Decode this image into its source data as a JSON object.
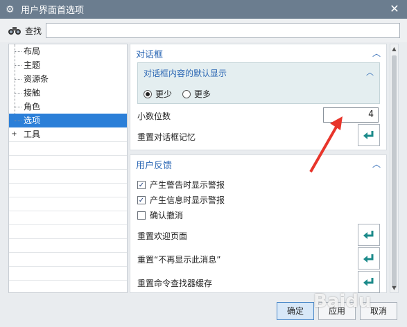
{
  "window": {
    "title": "用户界面首选项",
    "icons": {
      "app": "gear-icon",
      "close": "close-icon"
    }
  },
  "search": {
    "label": "查找",
    "value": "",
    "placeholder": ""
  },
  "tree": {
    "items": [
      {
        "label": "布局",
        "selected": false
      },
      {
        "label": "主题",
        "selected": false
      },
      {
        "label": "资源条",
        "selected": false
      },
      {
        "label": "接触",
        "selected": false
      },
      {
        "label": "角色",
        "selected": false
      },
      {
        "label": "选项",
        "selected": true
      },
      {
        "label": "工具",
        "selected": false,
        "expandable": true
      }
    ]
  },
  "dialog_section": {
    "title": "对话框",
    "subgroup": {
      "title": "对话框内容的默认显示",
      "options": [
        {
          "label": "更少",
          "checked": true
        },
        {
          "label": "更多",
          "checked": false
        }
      ]
    },
    "decimal_label": "小数位数",
    "decimal_value": "4",
    "reset_memory_label": "重置对话框记忆"
  },
  "feedback_section": {
    "title": "用户反馈",
    "checks": [
      {
        "label": "产生警告时显示警报",
        "checked": true
      },
      {
        "label": "产生信息时显示警报",
        "checked": true
      },
      {
        "label": "确认撤消",
        "checked": false
      }
    ],
    "reset_welcome_label": "重置欢迎页面",
    "reset_dont_show_label": "重置“不再显示此消息”",
    "reset_finder_label": "重置命令查找器缓存"
  },
  "buttons": {
    "ok": "确定",
    "apply": "应用",
    "cancel": "取消"
  },
  "watermark": "Baidu"
}
